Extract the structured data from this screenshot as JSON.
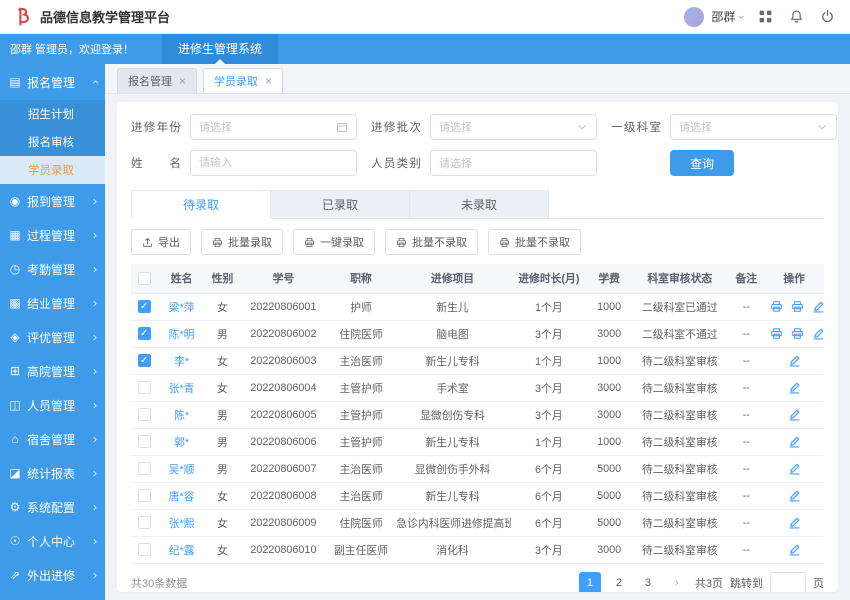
{
  "header": {
    "app_title": "品德信息教学管理平台",
    "user_name": "邵群"
  },
  "banner": {
    "welcome": "邵群 管理员，欢迎登录！",
    "system_tab": "进修生管理系统"
  },
  "sidebar": {
    "root": {
      "label": "报名管理",
      "icon": "enroll-icon"
    },
    "submenu": [
      "招生计划",
      "报名审核",
      "学员录取"
    ],
    "active_submenu": "学员录取",
    "items": [
      {
        "label": "报到管理",
        "icon": "checkin-icon"
      },
      {
        "label": "过程管理",
        "icon": "process-icon"
      },
      {
        "label": "考勤管理",
        "icon": "attendance-icon"
      },
      {
        "label": "结业管理",
        "icon": "graduation-icon"
      },
      {
        "label": "评优管理",
        "icon": "award-icon"
      },
      {
        "label": "高院管理",
        "icon": "hospital-icon"
      },
      {
        "label": "人员管理",
        "icon": "personnel-icon"
      },
      {
        "label": "宿舍管理",
        "icon": "dorm-icon"
      },
      {
        "label": "统计报表",
        "icon": "report-icon"
      },
      {
        "label": "系统配置",
        "icon": "settings-icon"
      },
      {
        "label": "个人中心",
        "icon": "profile-icon"
      },
      {
        "label": "外出进修",
        "icon": "external-icon"
      }
    ]
  },
  "view_tabs": [
    {
      "label": "报名管理",
      "active": false
    },
    {
      "label": "学员录取",
      "active": true
    }
  ],
  "filters": {
    "year_label": "进修年份",
    "year_placeholder": "请选择",
    "batch_label": "进修批次",
    "batch_placeholder": "请选择",
    "dept_label": "一级科室",
    "dept_placeholder": "请选择",
    "name_label": "姓名",
    "name_placeholder": "请输入",
    "type_label": "人员类别",
    "type_placeholder": "请选择",
    "search_button": "查询"
  },
  "status_tabs": [
    {
      "label": "待录取",
      "active": true
    },
    {
      "label": "已录取",
      "active": false
    },
    {
      "label": "未录取",
      "active": false
    }
  ],
  "actions": [
    {
      "label": "导出",
      "icon": "export-icon",
      "name": "export-button"
    },
    {
      "label": "批量录取",
      "icon": "print-icon",
      "name": "batch-admit-button"
    },
    {
      "label": "一键录取",
      "icon": "print-icon",
      "name": "one-click-admit-button"
    },
    {
      "label": "批量不录取",
      "icon": "print-icon",
      "name": "batch-reject-button"
    },
    {
      "label": "批量不录取",
      "icon": "print-icon",
      "name": "batch-reject-button-2"
    }
  ],
  "table": {
    "columns": [
      "姓名",
      "性别",
      "学号",
      "职称",
      "进修项目",
      "进修时长(月)",
      "学费",
      "科室审核状态",
      "备注",
      "操作"
    ],
    "rows": [
      {
        "checked": true,
        "name": "梁*萍",
        "gender": "女",
        "student_no": "20220806001",
        "title": "护师",
        "project": "新生儿",
        "duration": "1个月",
        "fee": "1000",
        "status": "二级科室已通过",
        "remark": "--",
        "ops": [
          "print",
          "print",
          "edit"
        ]
      },
      {
        "checked": true,
        "name": "陈*明",
        "gender": "男",
        "student_no": "20220806002",
        "title": "住院医师",
        "project": "脑电图",
        "duration": "3个月",
        "fee": "3000",
        "status": "二级科室不通过",
        "remark": "--",
        "ops": [
          "print",
          "print",
          "edit"
        ]
      },
      {
        "checked": true,
        "name": "李*",
        "gender": "女",
        "student_no": "20220806003",
        "title": "主治医师",
        "project": "新生儿专科",
        "duration": "1个月",
        "fee": "1000",
        "status": "待二级科室审核",
        "remark": "--",
        "ops": [
          "edit"
        ]
      },
      {
        "checked": false,
        "name": "张*青",
        "gender": "女",
        "student_no": "20220806004",
        "title": "主管护师",
        "project": "手术室",
        "duration": "3个月",
        "fee": "3000",
        "status": "待二级科室审核",
        "remark": "--",
        "ops": [
          "edit"
        ]
      },
      {
        "checked": false,
        "name": "陈*",
        "gender": "男",
        "student_no": "20220806005",
        "title": "主管护师",
        "project": "显微创伤专科",
        "duration": "3个月",
        "fee": "3000",
        "status": "待二级科室审核",
        "remark": "--",
        "ops": [
          "edit"
        ]
      },
      {
        "checked": false,
        "name": "郭*",
        "gender": "男",
        "student_no": "20220806006",
        "title": "主管护师",
        "project": "新生儿专科",
        "duration": "1个月",
        "fee": "1000",
        "status": "待二级科室审核",
        "remark": "--",
        "ops": [
          "edit"
        ]
      },
      {
        "checked": false,
        "name": "吴*顺",
        "gender": "男",
        "student_no": "20220806007",
        "title": "主治医师",
        "project": "显微创伤手外科",
        "duration": "6个月",
        "fee": "5000",
        "status": "待二级科室审核",
        "remark": "--",
        "ops": [
          "edit"
        ]
      },
      {
        "checked": false,
        "name": "唐*容",
        "gender": "女",
        "student_no": "20220806008",
        "title": "主治医师",
        "project": "新生儿专科",
        "duration": "6个月",
        "fee": "5000",
        "status": "待二级科室审核",
        "remark": "--",
        "ops": [
          "edit"
        ]
      },
      {
        "checked": false,
        "name": "张*熙",
        "gender": "女",
        "student_no": "20220806009",
        "title": "住院医师",
        "project": "急诊内科医师进修提高班",
        "duration": "6个月",
        "fee": "5000",
        "status": "待二级科室审核",
        "remark": "--",
        "ops": [
          "edit"
        ]
      },
      {
        "checked": false,
        "name": "纪*露",
        "gender": "女",
        "student_no": "20220806010",
        "title": "副主任医师",
        "project": "消化科",
        "duration": "3个月",
        "fee": "3000",
        "status": "待二级科室审核",
        "remark": "--",
        "ops": [
          "edit"
        ]
      }
    ]
  },
  "footer": {
    "total_text": "共30条数据",
    "pages": [
      "1",
      "2",
      "3"
    ],
    "active_page": "1",
    "total_pages": "共3页",
    "jump_label": "跳转到",
    "jump_suffix": "页"
  },
  "colors": {
    "primary": "#3D9BE9",
    "active_menu_text": "#E6A23C",
    "link": "#409EFF",
    "logo_red": "#E23B3B"
  }
}
